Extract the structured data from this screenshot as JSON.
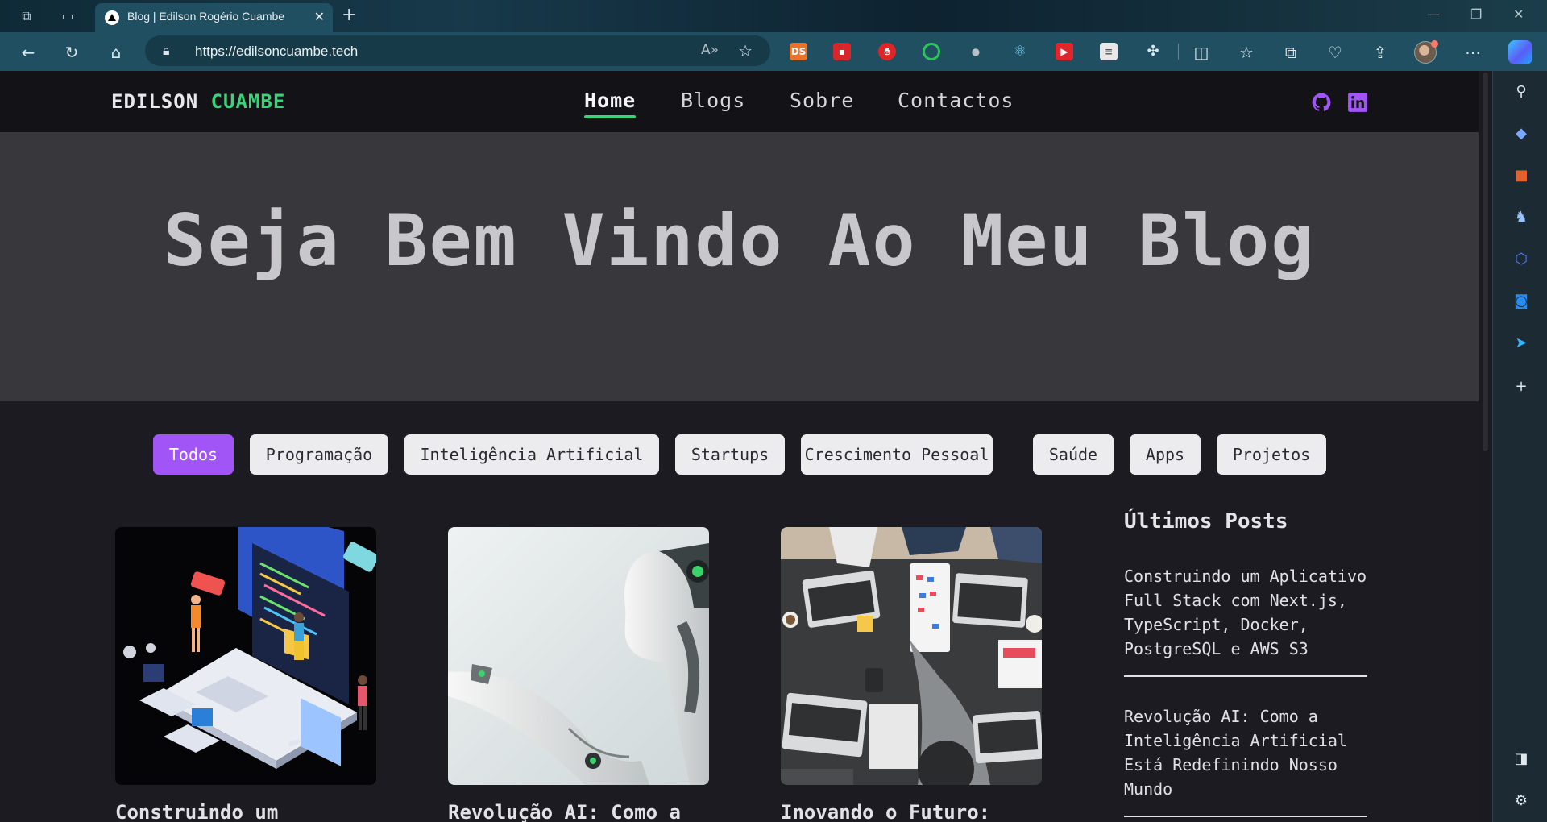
{
  "browser": {
    "tab_title": "Blog | Edilson Rogério Cuambe",
    "url": "https://edilsoncuambe.tech",
    "extensions": [
      "ds-extension-icon",
      "red-extension-icon",
      "hand-extension-icon",
      "green-ring-extension-icon",
      "figure-extension-icon",
      "react-devtools-icon",
      "youtube-extension-icon",
      "notes-extension-icon",
      "puzzle-extensions-icon"
    ],
    "ext_labels": {
      "ds": "DS"
    }
  },
  "nav": {
    "logo_first": "EDILSON",
    "logo_second": "CUAMBE",
    "links": [
      "Home",
      "Blogs",
      "Sobre",
      "Contactos"
    ]
  },
  "hero": {
    "title": "Seja Bem Vindo Ao Meu Blog"
  },
  "categories": [
    "Todos",
    "Programação",
    "Inteligência Artificial",
    "Startups",
    "Crescimento Pessoal",
    "Saúde",
    "Apps",
    "Projetos"
  ],
  "posts": [
    {
      "title": "Construindo um"
    },
    {
      "title": "Revolução AI: Como a"
    },
    {
      "title": "Inovando o Futuro:"
    }
  ],
  "latest": {
    "heading": "Últimos Posts",
    "items": [
      "Construindo um Aplicativo Full Stack com Next.js, TypeScript, Docker, PostgreSQL e AWS S3",
      "Revolução AI: Como a Inteligência Artificial Está Redefinindo Nosso Mundo"
    ]
  },
  "colors": {
    "accent_green": "#39d37a",
    "accent_purple": "#a155f7",
    "nav_bg": "#131217",
    "hero_bg": "#38373c",
    "page_bg": "#1c1b22"
  }
}
